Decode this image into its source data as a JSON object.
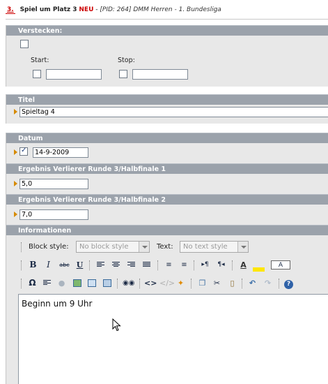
{
  "header": {
    "number": "3.",
    "title": "Spiel um Platz 3",
    "new_badge": "NEU",
    "separator": "-",
    "meta": "[PID: 264] DMM Herren - 1. Bundesliga"
  },
  "hide_section": {
    "label": "Verstecken:",
    "hidden": false,
    "start_label": "Start:",
    "start_checked": false,
    "start_value": "",
    "stop_label": "Stop:",
    "stop_checked": false,
    "stop_value": ""
  },
  "title_section": {
    "label": "Titel",
    "value": "Spieltag 4"
  },
  "date_section": {
    "label": "Datum",
    "checked": true,
    "value": "14-9-2009"
  },
  "result1_section": {
    "label": "Ergebnis Verlierer Runde 3/Halbfinale 1",
    "value": "5,0"
  },
  "result2_section": {
    "label": "Ergebnis Verlierer Runde 3/Halbfinale 2",
    "value": "7,0"
  },
  "info_section": {
    "label": "Informationen",
    "block_style_label": "Block style:",
    "block_style_value": "No block style",
    "text_style_label": "Text:",
    "text_style_value": "No text style",
    "content": "Beginn um 9 Uhr"
  },
  "toolbar_row2": {
    "bold": "B",
    "italic": "I",
    "strike": "abc",
    "underline": "U",
    "ltr": "▸¶",
    "rtl": "¶◂",
    "format": "A",
    "text_color": "A"
  },
  "toolbar_row3": {
    "special_char": "Ω",
    "source": "<>"
  },
  "colors": {
    "section_bar": "#9ba2ab",
    "panel": "#e8e8e8",
    "accent_red": "#cc0000",
    "arrow": "#d68a00"
  }
}
